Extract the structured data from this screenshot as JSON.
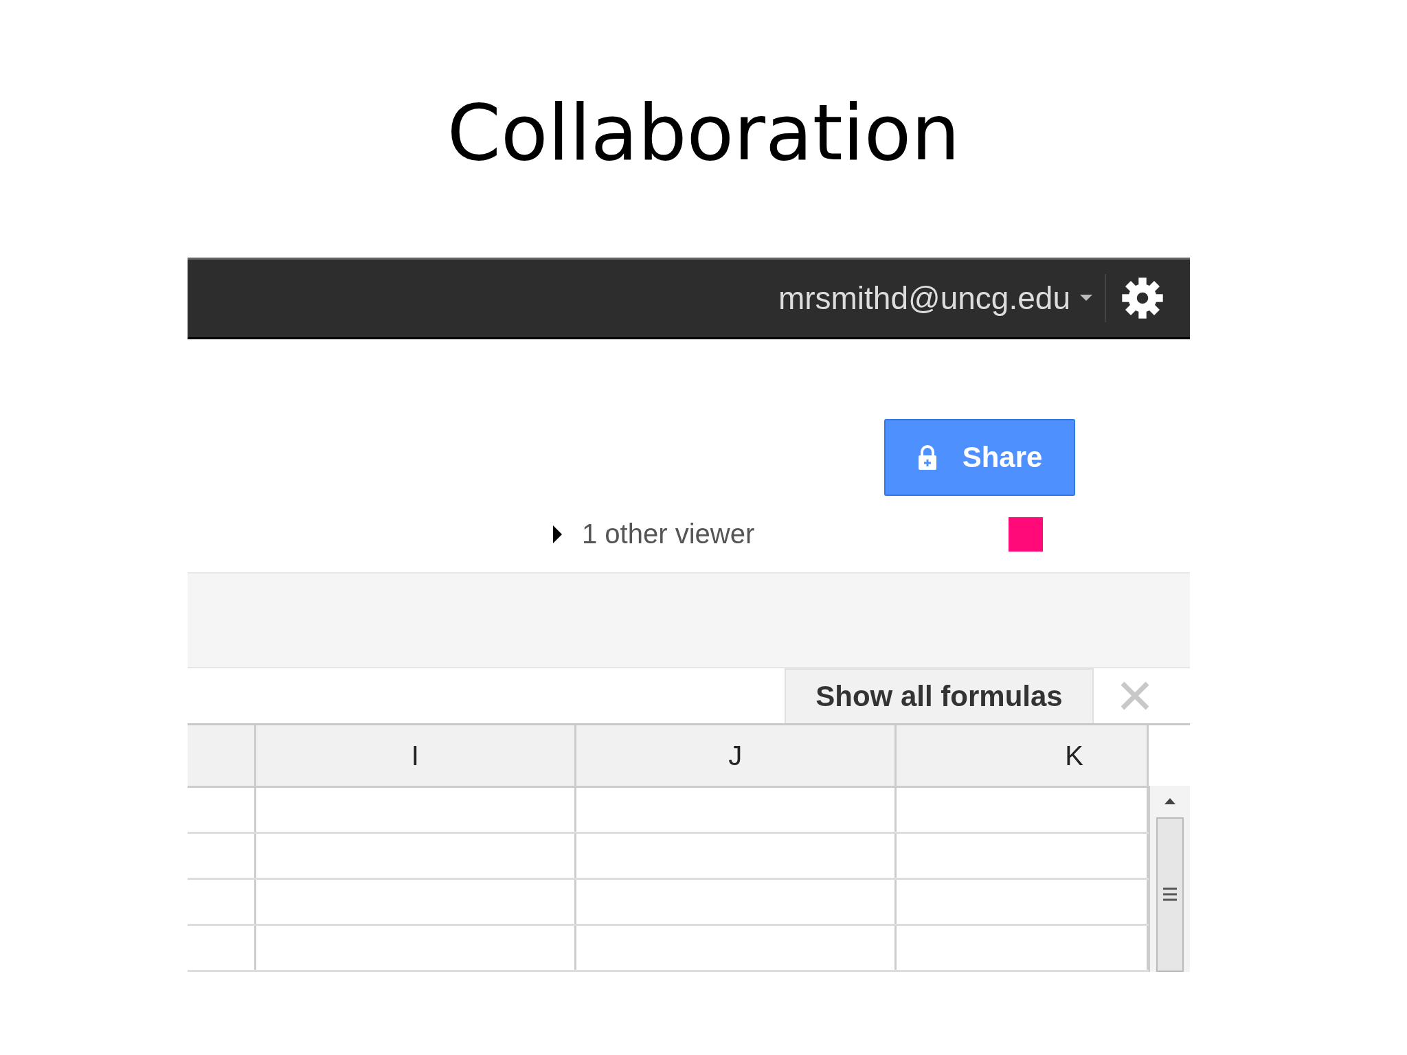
{
  "slide_title": "Collaboration",
  "top_bar": {
    "account": "mrsmithd@uncg.edu"
  },
  "share_button": {
    "label": "Share"
  },
  "viewers": {
    "label": "1 other viewer",
    "expanded": false,
    "people": [
      {
        "color": "#ff0a78"
      }
    ]
  },
  "formula_toggle": {
    "label": "Show all formulas"
  },
  "columns": [
    "I",
    "J",
    "K"
  ]
}
